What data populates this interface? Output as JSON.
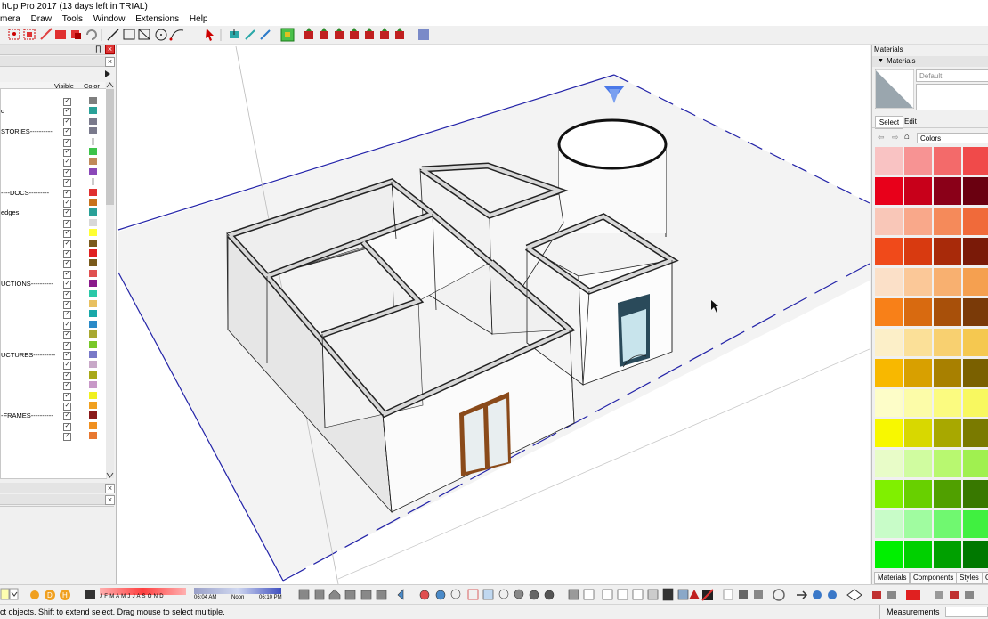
{
  "app": {
    "title": "hUp Pro 2017 (13 days left in TRIAL)"
  },
  "menu": [
    "mera",
    "Draw",
    "Tools",
    "Window",
    "Extensions",
    "Help"
  ],
  "toolbar_icons": [
    "select-tool",
    "eraser",
    "line",
    "rectangle",
    "circle",
    "arc",
    "paint-bucket",
    "push-pull",
    "move",
    "rotate",
    "scale",
    "offset",
    "tape",
    "text",
    "axes",
    "dimension",
    "section",
    "walk"
  ],
  "layers_panel": {
    "pin_label": "∏",
    "columns": {
      "visible": "Visible",
      "color": "Color"
    },
    "rows": [
      {
        "name": "",
        "color": "#7f7f7f"
      },
      {
        "name": "d",
        "color": "#2aa198"
      },
      {
        "name": "",
        "color": "#7a7a8c"
      },
      {
        "name": "STORIES----------",
        "color": "#7a7a8c"
      },
      {
        "name": "",
        "color": "#ffffff"
      },
      {
        "name": "",
        "color": "#3cc34a"
      },
      {
        "name": "",
        "color": "#c08a5a"
      },
      {
        "name": "",
        "color": "#8a48b8"
      },
      {
        "name": "",
        "color": "#ffffff"
      },
      {
        "name": "----DOCS---------",
        "color": "#e03030"
      },
      {
        "name": "",
        "color": "#c8721c"
      },
      {
        "name": "edges",
        "color": "#2aa198"
      },
      {
        "name": "",
        "color": "#d8d8d8"
      },
      {
        "name": "",
        "color": "#ffff33"
      },
      {
        "name": "",
        "color": "#7a5a1c"
      },
      {
        "name": "",
        "color": "#e02020"
      },
      {
        "name": "",
        "color": "#7a5a1c"
      },
      {
        "name": "",
        "color": "#e05050"
      },
      {
        "name": "UCTIONS----------",
        "color": "#8a1a8a"
      },
      {
        "name": "",
        "color": "#2ac8a8"
      },
      {
        "name": "",
        "color": "#e8c060"
      },
      {
        "name": "",
        "color": "#18a8a8"
      },
      {
        "name": "",
        "color": "#2a8ac8"
      },
      {
        "name": "",
        "color": "#a8a830"
      },
      {
        "name": "",
        "color": "#78c828"
      },
      {
        "name": "UCTURES----------",
        "color": "#7878c8"
      },
      {
        "name": "",
        "color": "#c8a8c8"
      },
      {
        "name": "",
        "color": "#a8a818"
      },
      {
        "name": "",
        "color": "#c898c8"
      },
      {
        "name": "",
        "color": "#f0f020"
      },
      {
        "name": "",
        "color": "#f0a020"
      },
      {
        "name": "-FRAMES----------",
        "color": "#8a1a1a"
      },
      {
        "name": "",
        "color": "#f09020"
      },
      {
        "name": "",
        "color": "#e87830"
      }
    ]
  },
  "materials_panel": {
    "title": "Materials",
    "section": "Materials",
    "default_name": "Default",
    "tabs": {
      "select": "Select",
      "edit": "Edit"
    },
    "library": "Colors",
    "swatches": [
      [
        "#f9c3c3",
        "#f79393",
        "#f36a6a",
        "#f04a4a"
      ],
      [
        "#e8001a",
        "#c8001a",
        "#8a0018",
        "#6a0010"
      ],
      [
        "#f9c7b8",
        "#f9a88a",
        "#f58a5a",
        "#f06a3a"
      ],
      [
        "#f04a1a",
        "#d83a10",
        "#a82a0a",
        "#7a1a08"
      ],
      [
        "#fbe0c8",
        "#fbc898",
        "#f8b070",
        "#f5a050"
      ],
      [
        "#f88018",
        "#d86a10",
        "#a8500a",
        "#7a3a08"
      ],
      [
        "#fcefc8",
        "#fbe098",
        "#f8d070",
        "#f5c850"
      ],
      [
        "#f8b800",
        "#d8a000",
        "#a88000",
        "#7a6000"
      ],
      [
        "#fdfdc8",
        "#fcfca8",
        "#fbfb80",
        "#f8f860"
      ],
      [
        "#f8f800",
        "#d8d800",
        "#a8a800",
        "#7a7a00"
      ],
      [
        "#e8fcc8",
        "#d0fca0",
        "#b8f870",
        "#a0f050"
      ],
      [
        "#80f000",
        "#68d000",
        "#50a000",
        "#387800"
      ],
      [
        "#c8fcc8",
        "#a0fca0",
        "#70f870",
        "#40f040"
      ],
      [
        "#00f000",
        "#00d000",
        "#00a000",
        "#007800"
      ]
    ],
    "bottom_tabs": [
      "Materials",
      "Components",
      "Styles",
      "O"
    ]
  },
  "bottom_toolbar": {
    "months": "J F M A M J J A S O N D",
    "time_start": "06:04 AM",
    "time_mid": "Noon",
    "time_end": "06:10 PM"
  },
  "statusbar": {
    "hint": "ct objects. Shift to extend select. Drag mouse to select multiple.",
    "measurements_label": "Measurements"
  }
}
